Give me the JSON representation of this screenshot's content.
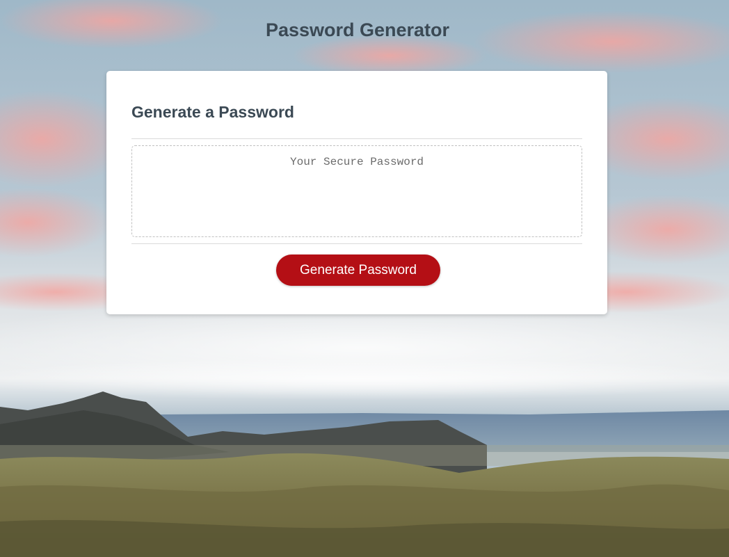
{
  "page": {
    "title": "Password Generator",
    "background": "mountain-landscape-photo"
  },
  "card": {
    "header": "Generate a Password",
    "password_field": {
      "placeholder": "Your Secure Password",
      "value": ""
    },
    "generate_button": {
      "label": "Generate Password",
      "color": "#b40f15"
    }
  },
  "colors": {
    "title_text": "#3b4954",
    "card_background": "#ffffff",
    "button_text": "#ffffff"
  }
}
